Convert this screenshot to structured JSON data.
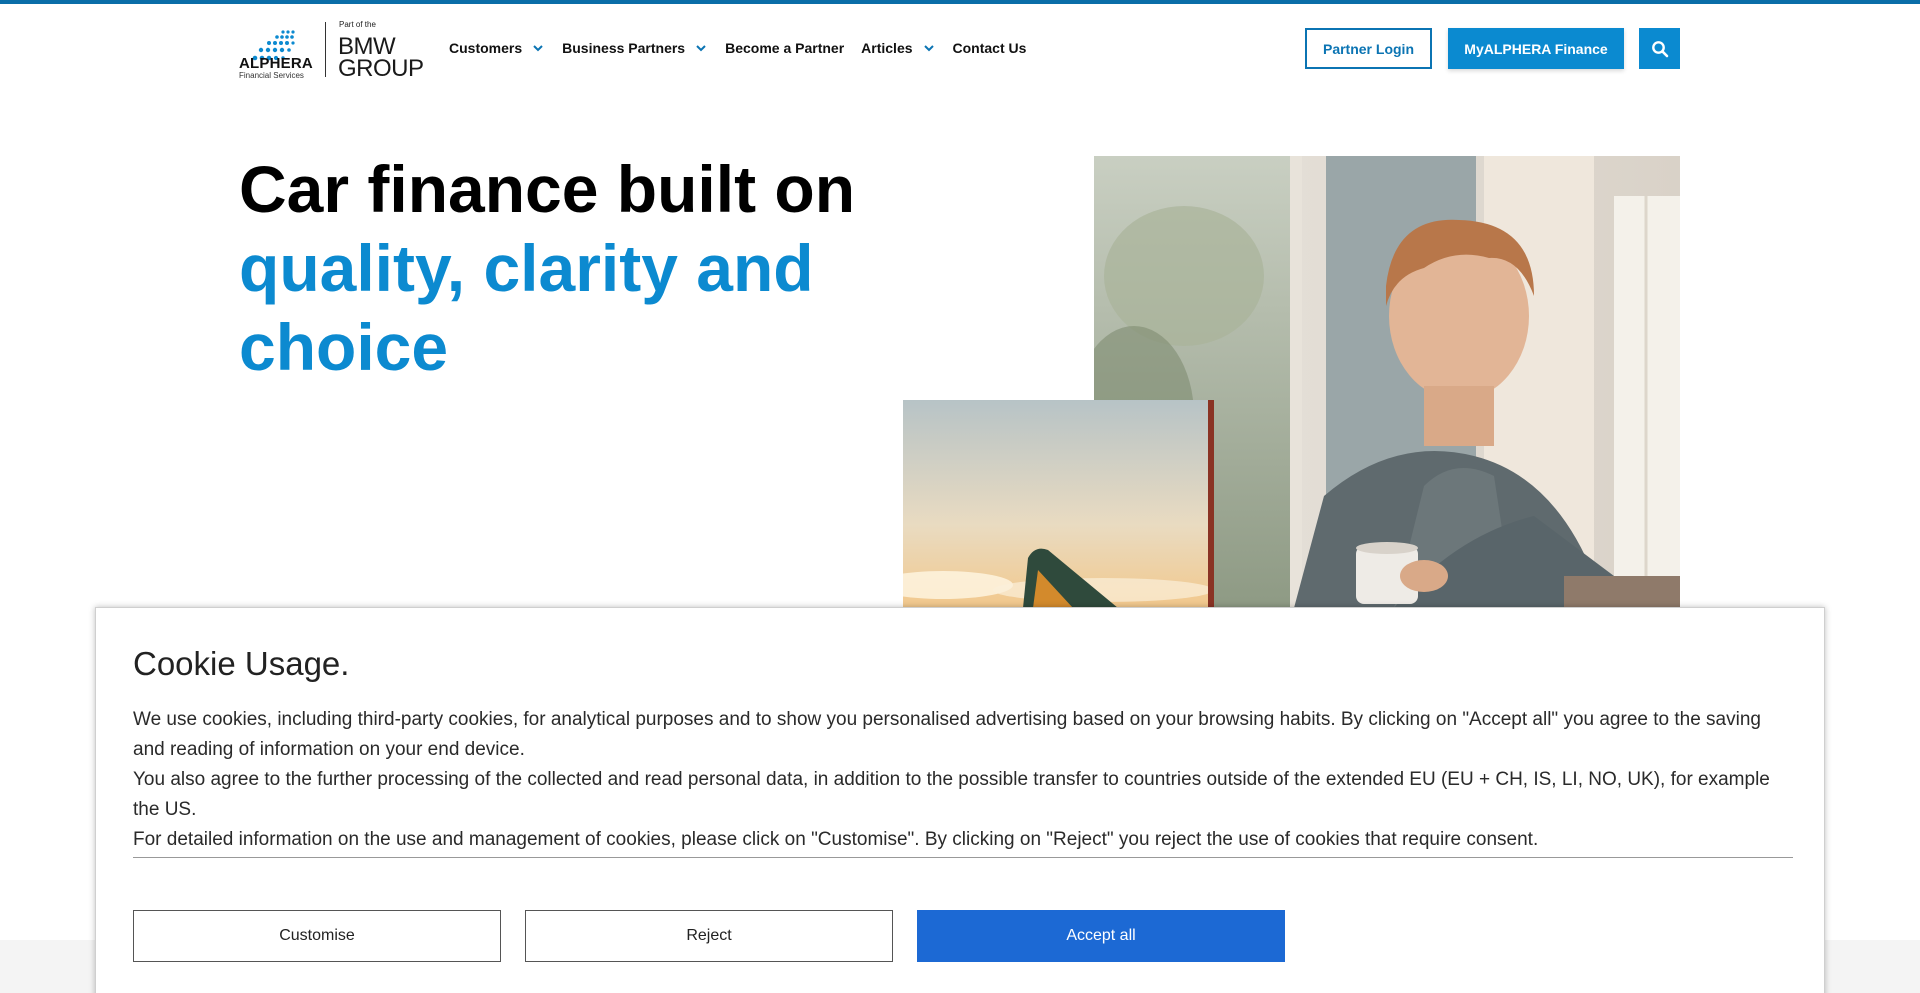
{
  "brand": {
    "name": "ALPHERA",
    "subline": "Financial Services",
    "group_prefix": "Part of the",
    "group_line1": "BMW",
    "group_line2": "GROUP"
  },
  "nav": {
    "items": [
      {
        "label": "Customers",
        "dropdown": true
      },
      {
        "label": "Business Partners",
        "dropdown": true
      },
      {
        "label": "Become a Partner",
        "dropdown": false
      },
      {
        "label": "Articles",
        "dropdown": true
      },
      {
        "label": "Contact Us",
        "dropdown": false
      }
    ],
    "partner_login": "Partner Login",
    "my_alphera": "MyALPHERA Finance",
    "search_icon": "search-icon"
  },
  "hero": {
    "title_part1": "Car finance built on ",
    "title_accent": "quality, clarity and choice"
  },
  "cookie": {
    "title": "Cookie Usage.",
    "paragraphs": [
      "We use cookies, including third-party cookies, for analytical purposes and to show you personalised advertising based on your browsing habits. By clicking on \"Accept all\" you agree to the saving and reading of information on your end device.",
      "You also agree to the further processing of the collected and read personal data, in addition to the possible transfer to countries outside of the extended EU (EU + CH, IS, LI, NO, UK), for example the US.",
      "For detailed information on the use and management of cookies, please click on \"Customise\". By clicking on \"Reject\" you reject the use of cookies that require consent."
    ],
    "customise": "Customise",
    "reject": "Reject",
    "accept": "Accept all"
  },
  "colors": {
    "accent": "#0c8ad0",
    "primary_button": "#1c69d4",
    "top_bar": "#0a6ea8"
  }
}
